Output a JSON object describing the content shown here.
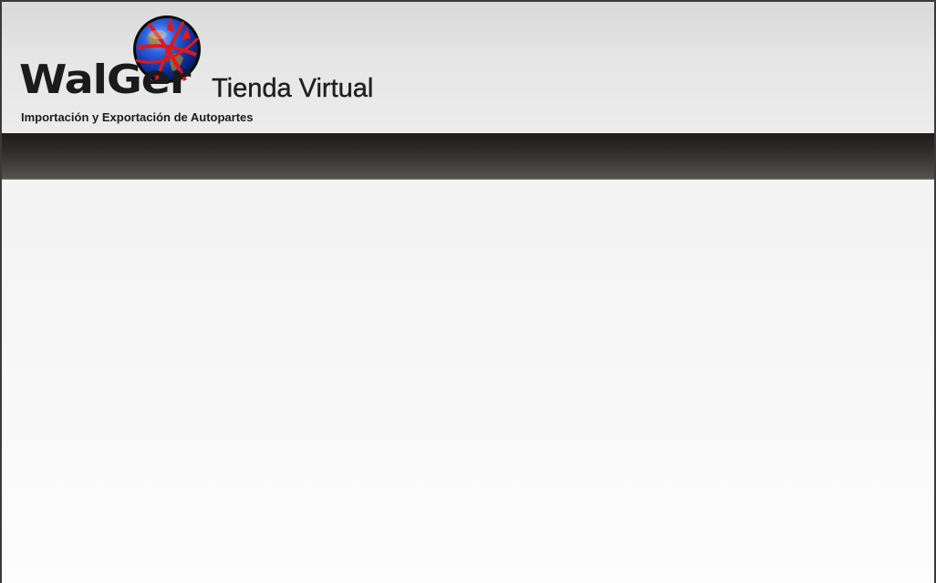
{
  "header": {
    "brand": "WalGer",
    "title": "Tienda Virtual",
    "tagline": "Importación y Exportación de Autopartes",
    "logo_icon": "globe-icon"
  },
  "colors": {
    "header_bg": "#e6e6e6",
    "navbar_bg": "#2f2c2b",
    "text": "#1b1b1b",
    "globe_blue": "#1f4fd6",
    "globe_red": "#e01818"
  }
}
